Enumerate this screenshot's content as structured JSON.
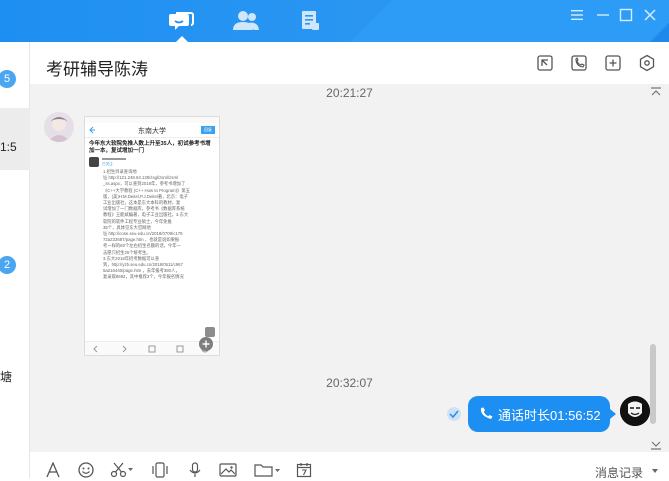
{
  "colors": {
    "accent": "#1e8ff2",
    "chat_bg": "#f2f2f2",
    "badge": "#4aa6f1"
  },
  "top_nav": [
    {
      "name": "messages",
      "icon": "chat-bubble-icon",
      "active": true
    },
    {
      "name": "contacts",
      "icon": "contacts-icon",
      "active": false
    },
    {
      "name": "files",
      "icon": "document-icon",
      "active": false
    }
  ],
  "window_controls": [
    "menu-icon",
    "minimize-icon",
    "maximize-icon",
    "close-icon"
  ],
  "left_list": {
    "badge1": "5",
    "time1": "1:5",
    "badge2": "2",
    "text3": "塘"
  },
  "chat": {
    "title": "考研辅导陈涛",
    "header_icons": [
      "screenshot-icon",
      "phone-icon",
      "add-member-icon",
      "settings-hexagon-icon"
    ],
    "timestamp1": "20:21:27",
    "timestamp2": "20:32:07",
    "image_message": {
      "nav_title": "东南大学",
      "nav_button": "回复",
      "headline": "今年东大软院免推人数上升至35人，初试参考书增加一本，复试增加一门",
      "sub": "已关注",
      "body_lines": [
        "1.招生目录查询地",
        "址 http://121.248.63.139/zsgl/zsml/zsml",
        "_ss.aspx，可以查到2019年，参考书增加了",
        "《C++大学教程 (C++ How to Program)》第五",
        "版，(美)H.M.Deitel,P.J.Deitel著，北京：电子",
        "工业出版社，这本是东大本科的教材，复",
        "试增加了一门数据库，参考书《数据库系统",
        "教程》王能斌编著，电子工业出版社。3.东大",
        "软院的软件工程专业硕士，今年免推",
        "35个，具体见东大官网地",
        "址 http://cose.seu.edu.cn/2018/0709/c179",
        "72a232687/page.htm ，也就是说如果报",
        "考一样的60个左右招生名额的话，今年一",
        "志愿只招生25个统考生。",
        "3.东大2018年招考数据可以查",
        "到，http://yzb.seu.edu.cn/2018/0511/c967",
        "5a216440/page.htm ，去年报考380人，",
        "复录取8692，其中推荐3个，今年报名情况"
      ]
    },
    "call_message": {
      "icon": "phone-icon",
      "text": "通话时长01:56:52"
    }
  },
  "toolbar": {
    "items": [
      "font-icon",
      "emoji-icon",
      "scissors-icon",
      "vibrate-icon",
      "microphone-icon",
      "image-icon",
      "folder-icon",
      "calendar-icon"
    ],
    "history_label": "消息记录"
  }
}
